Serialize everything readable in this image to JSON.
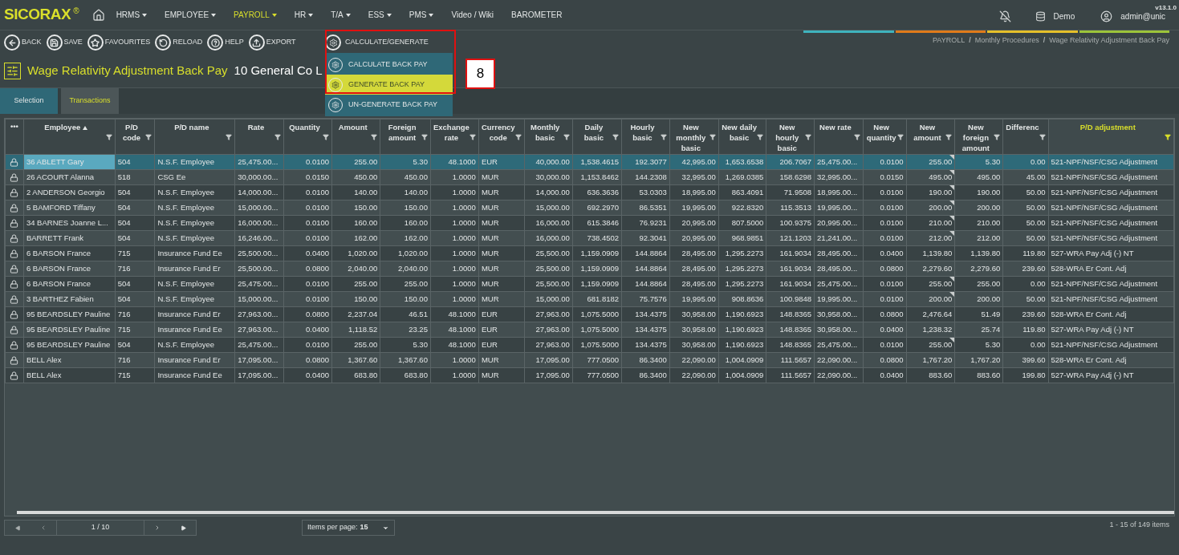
{
  "nav": {
    "brand": "SICORAX",
    "brand_mark": "®",
    "items": [
      {
        "label": "HRMS",
        "dropdown": true,
        "selected": false
      },
      {
        "label": "EMPLOYEE",
        "dropdown": true,
        "selected": false
      },
      {
        "label": "PAYROLL",
        "dropdown": true,
        "selected": true
      },
      {
        "label": "HR",
        "dropdown": true,
        "selected": false
      },
      {
        "label": "T/A",
        "dropdown": true,
        "selected": false
      },
      {
        "label": "ESS",
        "dropdown": true,
        "selected": false
      },
      {
        "label": "PMS",
        "dropdown": true,
        "selected": false
      },
      {
        "label": "Video / Wiki",
        "dropdown": false,
        "selected": false
      },
      {
        "label": "BAROMETER",
        "dropdown": false,
        "selected": false
      }
    ],
    "database": "Demo",
    "user": "admin@unic",
    "version": "v13.1.0"
  },
  "toolbar": {
    "buttons": [
      {
        "kind": "back",
        "label": "BACK"
      },
      {
        "kind": "save",
        "label": "SAVE"
      },
      {
        "kind": "favourites",
        "label": "FAVOURITES"
      },
      {
        "kind": "reload",
        "label": "RELOAD"
      },
      {
        "kind": "help",
        "label": "HELP"
      },
      {
        "kind": "export",
        "label": "EXPORT"
      }
    ],
    "action_menu": {
      "label": "CALCULATE/GENERATE",
      "items": [
        {
          "label": "CALCULATE BACK PAY",
          "selected": false
        },
        {
          "label": "GENERATE BACK PAY",
          "selected": true
        },
        {
          "label": "UN-GENERATE BACK PAY",
          "selected": false
        }
      ]
    }
  },
  "annotation": {
    "label": "8"
  },
  "breadcrumb": [
    "PAYROLL",
    "/",
    "Monthly Procedures",
    "/",
    "Wage Relativity Adjustment Back Pay"
  ],
  "page_title": "Wage Relativity Adjustment Back Pay",
  "company": "10 General Co L",
  "tabs": [
    {
      "label": "Selection",
      "selected": false
    },
    {
      "label": "Transactions",
      "selected": true
    }
  ],
  "table": {
    "options_label": "•••",
    "columns": [
      {
        "label": "Employee",
        "filter": true,
        "sorted": true,
        "highlighted": false
      },
      {
        "label": "P/D code",
        "filter": true,
        "sorted": false,
        "highlighted": false
      },
      {
        "label": "P/D name",
        "filter": true,
        "sorted": false,
        "highlighted": false
      },
      {
        "label": "Rate",
        "filter": true,
        "sorted": false,
        "highlighted": false
      },
      {
        "label": "Quantity",
        "filter": true,
        "sorted": false,
        "highlighted": false
      },
      {
        "label": "Amount",
        "filter": true,
        "sorted": false,
        "highlighted": false
      },
      {
        "label": "Foreign amount",
        "filter": true,
        "sorted": false,
        "highlighted": false
      },
      {
        "label": "Exchange rate",
        "filter": true,
        "sorted": false,
        "highlighted": false
      },
      {
        "label": "Currency code",
        "filter": true,
        "sorted": false,
        "highlighted": false
      },
      {
        "label": "Monthly basic",
        "filter": true,
        "sorted": false,
        "highlighted": false
      },
      {
        "label": "Daily basic",
        "filter": true,
        "sorted": false,
        "highlighted": false
      },
      {
        "label": "Hourly basic",
        "filter": true,
        "sorted": false,
        "highlighted": false
      },
      {
        "label": "New monthly basic",
        "filter": true,
        "sorted": false,
        "highlighted": false
      },
      {
        "label": "New daily basic",
        "filter": true,
        "sorted": false,
        "highlighted": false
      },
      {
        "label": "New hourly basic",
        "filter": true,
        "sorted": false,
        "highlighted": false
      },
      {
        "label": "New rate",
        "filter": true,
        "sorted": false,
        "highlighted": false
      },
      {
        "label": "New quantity",
        "filter": true,
        "sorted": false,
        "highlighted": false
      },
      {
        "label": "New amount",
        "filter": true,
        "sorted": false,
        "highlighted": false
      },
      {
        "label": "New foreign amount",
        "filter": true,
        "sorted": false,
        "highlighted": false
      },
      {
        "label": "Differenc",
        "filter": true,
        "sorted": false,
        "highlighted": false
      },
      {
        "label": "P/D adjustment",
        "filter": true,
        "sorted": false,
        "highlighted": true
      }
    ],
    "rows": [
      {
        "selected": true,
        "flagged": true,
        "cells": [
          "36 ABLETT Gary",
          "504",
          "N.S.F. Employee",
          "25,475.00...",
          "0.0100",
          "255.00",
          "5.30",
          "48.1000",
          "EUR",
          "40,000.00",
          "1,538.4615",
          "192.3077",
          "42,995.00",
          "1,653.6538",
          "206.7067",
          "25,475.00...",
          "0.0100",
          "255.00",
          "5.30",
          "0.00",
          "521-NPF/NSF/CSG Adjustment"
        ]
      },
      {
        "selected": false,
        "flagged": true,
        "cells": [
          "26 ACOURT Alanna",
          "518",
          "CSG Ee",
          "30,000.00...",
          "0.0150",
          "450.00",
          "450.00",
          "1.0000",
          "MUR",
          "30,000.00",
          "1,153.8462",
          "144.2308",
          "32,995.00",
          "1,269.0385",
          "158.6298",
          "32,995.00...",
          "0.0150",
          "495.00",
          "495.00",
          "45.00",
          "521-NPF/NSF/CSG Adjustment"
        ]
      },
      {
        "selected": false,
        "flagged": true,
        "cells": [
          "2 ANDERSON Georgio",
          "504",
          "N.S.F. Employee",
          "14,000.00...",
          "0.0100",
          "140.00",
          "140.00",
          "1.0000",
          "MUR",
          "14,000.00",
          "636.3636",
          "53.0303",
          "18,995.00",
          "863.4091",
          "71.9508",
          "18,995.00...",
          "0.0100",
          "190.00",
          "190.00",
          "50.00",
          "521-NPF/NSF/CSG Adjustment"
        ]
      },
      {
        "selected": false,
        "flagged": true,
        "cells": [
          "5 BAMFORD Tiffany",
          "504",
          "N.S.F. Employee",
          "15,000.00...",
          "0.0100",
          "150.00",
          "150.00",
          "1.0000",
          "MUR",
          "15,000.00",
          "692.2970",
          "86.5351",
          "19,995.00",
          "922.8320",
          "115.3513",
          "19,995.00...",
          "0.0100",
          "200.00",
          "200.00",
          "50.00",
          "521-NPF/NSF/CSG Adjustment"
        ]
      },
      {
        "selected": false,
        "flagged": true,
        "cells": [
          "34 BARNES Joanne L...",
          "504",
          "N.S.F. Employee",
          "16,000.00...",
          "0.0100",
          "160.00",
          "160.00",
          "1.0000",
          "MUR",
          "16,000.00",
          "615.3846",
          "76.9231",
          "20,995.00",
          "807.5000",
          "100.9375",
          "20,995.00...",
          "0.0100",
          "210.00",
          "210.00",
          "50.00",
          "521-NPF/NSF/CSG Adjustment"
        ]
      },
      {
        "selected": false,
        "flagged": true,
        "cells": [
          "BARRETT Frank",
          "504",
          "N.S.F. Employee",
          "16,246.00...",
          "0.0100",
          "162.00",
          "162.00",
          "1.0000",
          "MUR",
          "16,000.00",
          "738.4502",
          "92.3041",
          "20,995.00",
          "968.9851",
          "121.1203",
          "21,241.00...",
          "0.0100",
          "212.00",
          "212.00",
          "50.00",
          "521-NPF/NSF/CSG Adjustment"
        ]
      },
      {
        "selected": false,
        "flagged": false,
        "cells": [
          "6 BARSON France",
          "715",
          "Insurance Fund Ee",
          "25,500.00...",
          "0.0400",
          "1,020.00",
          "1,020.00",
          "1.0000",
          "MUR",
          "25,500.00",
          "1,159.0909",
          "144.8864",
          "28,495.00",
          "1,295.2273",
          "161.9034",
          "28,495.00...",
          "0.0400",
          "1,139.80",
          "1,139.80",
          "119.80",
          "527-WRA Pay Adj (-) NT"
        ]
      },
      {
        "selected": false,
        "flagged": false,
        "cells": [
          "6 BARSON France",
          "716",
          "Insurance Fund Er",
          "25,500.00...",
          "0.0800",
          "2,040.00",
          "2,040.00",
          "1.0000",
          "MUR",
          "25,500.00",
          "1,159.0909",
          "144.8864",
          "28,495.00",
          "1,295.2273",
          "161.9034",
          "28,495.00...",
          "0.0800",
          "2,279.60",
          "2,279.60",
          "239.60",
          "528-WRA Er Cont. Adj"
        ]
      },
      {
        "selected": false,
        "flagged": true,
        "cells": [
          "6 BARSON France",
          "504",
          "N.S.F. Employee",
          "25,475.00...",
          "0.0100",
          "255.00",
          "255.00",
          "1.0000",
          "MUR",
          "25,500.00",
          "1,159.0909",
          "144.8864",
          "28,495.00",
          "1,295.2273",
          "161.9034",
          "25,475.00...",
          "0.0100",
          "255.00",
          "255.00",
          "0.00",
          "521-NPF/NSF/CSG Adjustment"
        ]
      },
      {
        "selected": false,
        "flagged": true,
        "cells": [
          "3 BARTHEZ Fabien",
          "504",
          "N.S.F. Employee",
          "15,000.00...",
          "0.0100",
          "150.00",
          "150.00",
          "1.0000",
          "MUR",
          "15,000.00",
          "681.8182",
          "75.7576",
          "19,995.00",
          "908.8636",
          "100.9848",
          "19,995.00...",
          "0.0100",
          "200.00",
          "200.00",
          "50.00",
          "521-NPF/NSF/CSG Adjustment"
        ]
      },
      {
        "selected": false,
        "flagged": false,
        "cells": [
          "95 BEARDSLEY Pauline",
          "716",
          "Insurance Fund Er",
          "27,963.00...",
          "0.0800",
          "2,237.04",
          "46.51",
          "48.1000",
          "EUR",
          "27,963.00",
          "1,075.5000",
          "134.4375",
          "30,958.00",
          "1,190.6923",
          "148.8365",
          "30,958.00...",
          "0.0800",
          "2,476.64",
          "51.49",
          "239.60",
          "528-WRA Er Cont. Adj"
        ]
      },
      {
        "selected": false,
        "flagged": false,
        "cells": [
          "95 BEARDSLEY Pauline",
          "715",
          "Insurance Fund Ee",
          "27,963.00...",
          "0.0400",
          "1,118.52",
          "23.25",
          "48.1000",
          "EUR",
          "27,963.00",
          "1,075.5000",
          "134.4375",
          "30,958.00",
          "1,190.6923",
          "148.8365",
          "30,958.00...",
          "0.0400",
          "1,238.32",
          "25.74",
          "119.80",
          "527-WRA Pay Adj (-) NT"
        ]
      },
      {
        "selected": false,
        "flagged": true,
        "cells": [
          "95 BEARDSLEY Pauline",
          "504",
          "N.S.F. Employee",
          "25,475.00...",
          "0.0100",
          "255.00",
          "5.30",
          "48.1000",
          "EUR",
          "27,963.00",
          "1,075.5000",
          "134.4375",
          "30,958.00",
          "1,190.6923",
          "148.8365",
          "25,475.00...",
          "0.0100",
          "255.00",
          "5.30",
          "0.00",
          "521-NPF/NSF/CSG Adjustment"
        ]
      },
      {
        "selected": false,
        "flagged": false,
        "cells": [
          "BELL Alex",
          "716",
          "Insurance Fund Er",
          "17,095.00...",
          "0.0800",
          "1,367.60",
          "1,367.60",
          "1.0000",
          "MUR",
          "17,095.00",
          "777.0500",
          "86.3400",
          "22,090.00",
          "1,004.0909",
          "111.5657",
          "22,090.00...",
          "0.0800",
          "1,767.20",
          "1,767.20",
          "399.60",
          "528-WRA Er Cont. Adj"
        ]
      },
      {
        "selected": false,
        "flagged": false,
        "cells": [
          "BELL Alex",
          "715",
          "Insurance Fund Ee",
          "17,095.00...",
          "0.0400",
          "683.80",
          "683.80",
          "1.0000",
          "MUR",
          "17,095.00",
          "777.0500",
          "86.3400",
          "22,090.00",
          "1,004.0909",
          "111.5657",
          "22,090.00...",
          "0.0400",
          "883.60",
          "883.60",
          "199.80",
          "527-WRA Pay Adj (-) NT"
        ]
      }
    ]
  },
  "pager": {
    "page": "1 / 10",
    "per_page_label": "Items per page:",
    "per_page": "15",
    "summary": "1 - 15 of 149 items"
  }
}
